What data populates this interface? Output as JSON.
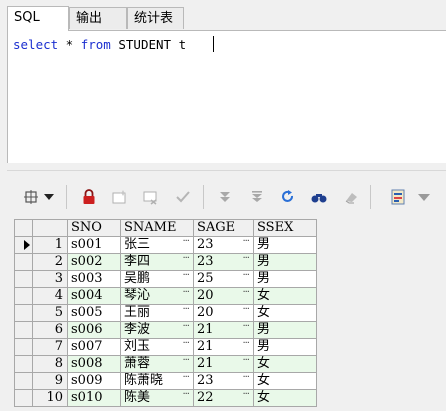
{
  "tabs": [
    {
      "label": "SQL",
      "active": true
    },
    {
      "label": "输出",
      "active": false
    },
    {
      "label": "统计表",
      "active": false
    }
  ],
  "editor": {
    "kw1": "select",
    "t1": " * ",
    "kw2": "from",
    "t2": " STUDENT t"
  },
  "toolbar": {
    "icons": [
      "grid-layout-icon",
      "dropdown-icon",
      "lock-icon",
      "new-record-icon",
      "delete-record-icon",
      "post-check-icon",
      "first-record-icon",
      "last-record-icon",
      "refresh-icon",
      "find-icon",
      "clear-icon",
      "export-icon",
      "export-dropdown-icon"
    ]
  },
  "grid": {
    "columns": [
      "SNO",
      "SNAME",
      "SAGE",
      "SSEX"
    ],
    "rows": [
      {
        "n": "1",
        "sno": "s001",
        "sname": "张三",
        "sage": "23",
        "ssex": "男"
      },
      {
        "n": "2",
        "sno": "s002",
        "sname": "李四",
        "sage": "23",
        "ssex": "男"
      },
      {
        "n": "3",
        "sno": "s003",
        "sname": "吴鹏",
        "sage": "25",
        "ssex": "男"
      },
      {
        "n": "4",
        "sno": "s004",
        "sname": "琴沁",
        "sage": "20",
        "ssex": "女"
      },
      {
        "n": "5",
        "sno": "s005",
        "sname": "王丽",
        "sage": "20",
        "ssex": "女"
      },
      {
        "n": "6",
        "sno": "s006",
        "sname": "李波",
        "sage": "21",
        "ssex": "男"
      },
      {
        "n": "7",
        "sno": "s007",
        "sname": "刘玉",
        "sage": "21",
        "ssex": "男"
      },
      {
        "n": "8",
        "sno": "s008",
        "sname": "萧蓉",
        "sage": "21",
        "ssex": "女"
      },
      {
        "n": "9",
        "sno": "s009",
        "sname": "陈萧晓",
        "sage": "23",
        "ssex": "女"
      },
      {
        "n": "10",
        "sno": "s010",
        "sname": "陈美",
        "sage": "22",
        "ssex": "女"
      }
    ],
    "cell_button": "···",
    "selected_row": 1
  },
  "colors": {
    "keyword": "#1b2fd0",
    "alt_row": "#e9f9e9",
    "lock": "#cc1f1f"
  }
}
